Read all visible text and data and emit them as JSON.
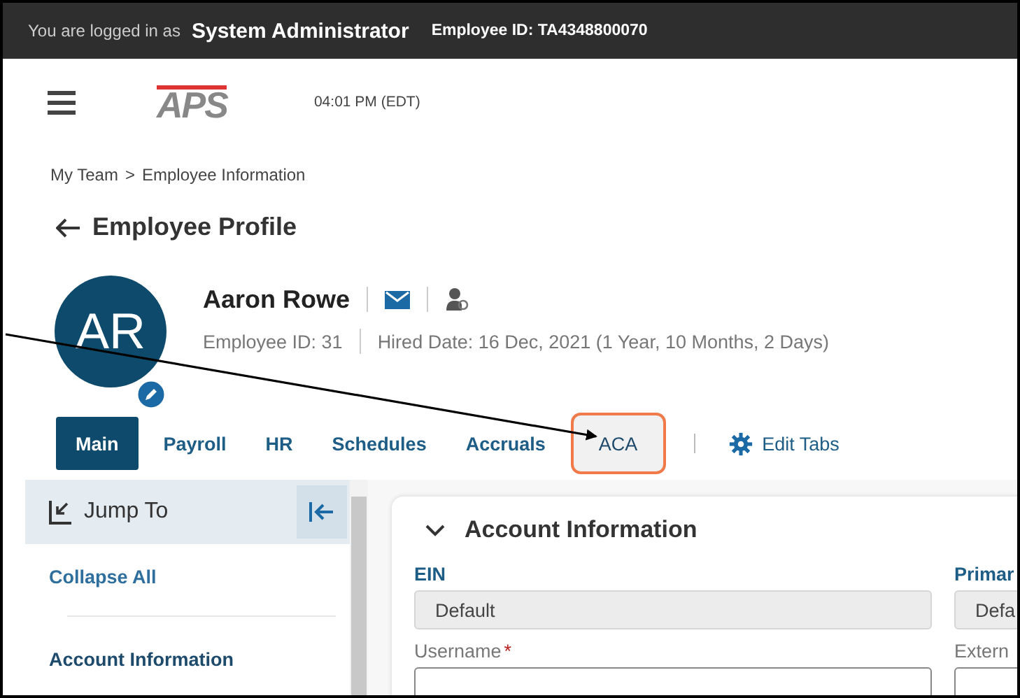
{
  "top_bar": {
    "prefix": "You are logged in as",
    "user": "System Administrator",
    "employee_id": "Employee ID: TA4348800070"
  },
  "header": {
    "logo": "APS",
    "time": "04:01 PM (EDT)"
  },
  "breadcrumb": [
    "My Team",
    ">",
    "Employee Information"
  ],
  "page_title": "Employee Profile",
  "profile": {
    "initials": "AR",
    "name": "Aaron Rowe",
    "employee_id": "Employee ID: 31",
    "hired_date": "Hired Date: 16 Dec, 2021 (1 Year, 10 Months, 2 Days)"
  },
  "tabs": [
    {
      "label": "Main",
      "selected": true,
      "highlighted": false
    },
    {
      "label": "Payroll",
      "selected": false,
      "highlighted": false
    },
    {
      "label": "HR",
      "selected": false,
      "highlighted": false
    },
    {
      "label": "Schedules",
      "selected": false,
      "highlighted": false
    },
    {
      "label": "Accruals",
      "selected": false,
      "highlighted": false
    },
    {
      "label": "ACA",
      "selected": false,
      "highlighted": true
    }
  ],
  "edit_tabs": "Edit Tabs",
  "sidebar": {
    "title": "Jump To",
    "collapse_all": "Collapse All",
    "items": [
      "Account Information"
    ]
  },
  "section": {
    "title": "Account Information",
    "expanded": true,
    "fields": [
      {
        "label": "EIN",
        "value": "Default",
        "kind": "readonly"
      },
      {
        "label": "Primar",
        "value": "Defa",
        "kind": "readonly"
      },
      {
        "label": "Username",
        "required_mark": "*",
        "kind": "input"
      },
      {
        "label": "Extern",
        "kind": "input"
      }
    ]
  }
}
